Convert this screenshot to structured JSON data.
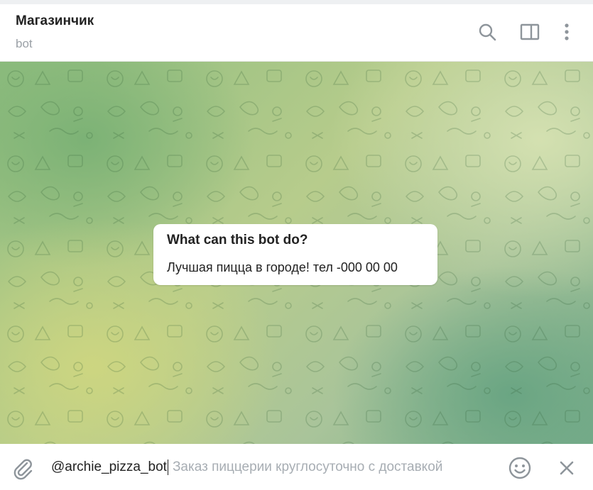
{
  "header": {
    "title": "Магазинчик",
    "subtitle": "bot",
    "icons": [
      "search-icon",
      "sidebar-toggle-icon",
      "more-vertical-icon"
    ]
  },
  "intro_card": {
    "title": "What can this bot do?",
    "text": "Лучшая пицца в городе! тел -000 00 00"
  },
  "composer": {
    "value": "@archie_pizza_bot",
    "placeholder": "Заказ пиццерии круглосуточно с доставкой",
    "icons": [
      "attach-icon",
      "emoji-icon",
      "close-icon"
    ]
  },
  "colors": {
    "header_bg": "#ffffff",
    "title_text": "#222222",
    "subtitle_text": "#9aa0a6",
    "icon_gray": "#8e959b",
    "wallpaper_green": "#8fbd7e",
    "wallpaper_yellow": "#cfd685",
    "wallpaper_teal": "#68a482"
  }
}
